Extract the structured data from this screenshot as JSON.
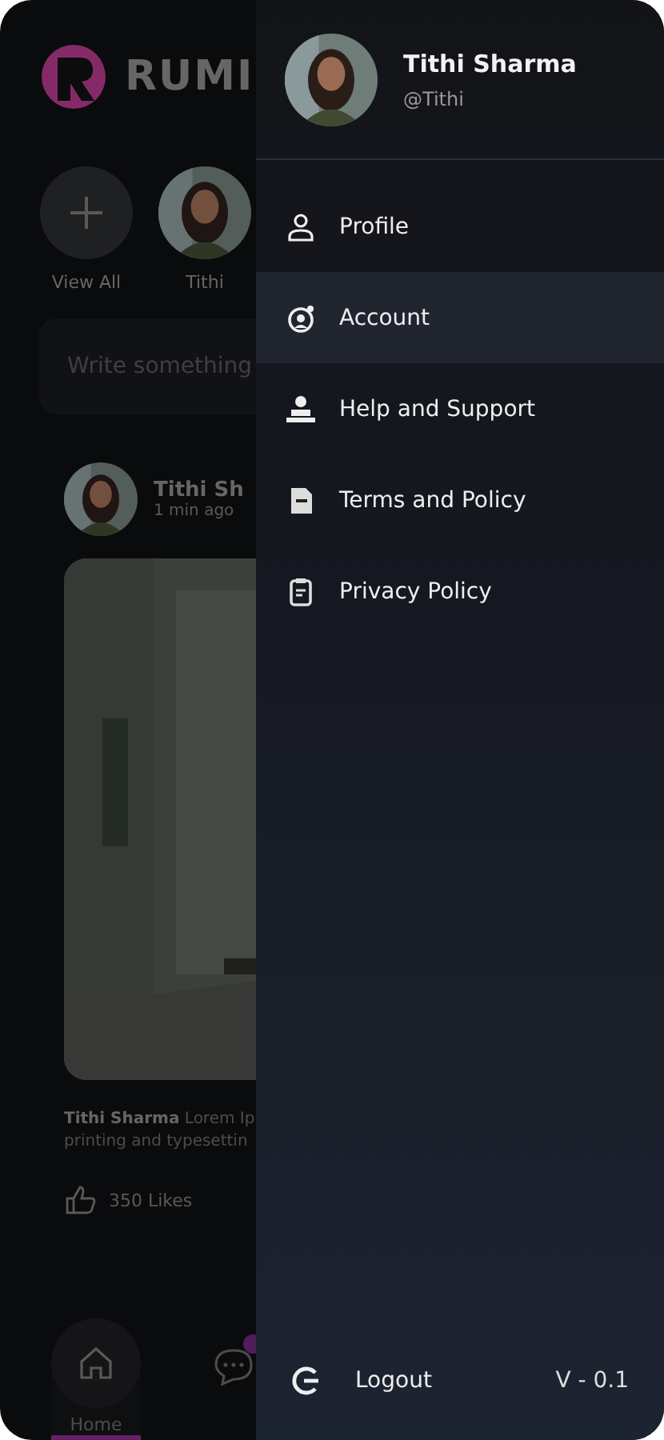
{
  "feed": {
    "logo_text": "RUMI",
    "stories": [
      {
        "kind": "add",
        "label": "View All"
      },
      {
        "kind": "person",
        "label": "Tithi"
      }
    ],
    "composer": {
      "placeholder": "Write something"
    },
    "post": {
      "author": "Tithi Sh",
      "time": "1 min ago",
      "caption_author": "Tithi Sharma",
      "caption_line1": "Lorem Ip",
      "caption_line2": "printing and typesettin",
      "likes": "350 Likes"
    },
    "nav": [
      {
        "kind": "home",
        "label": "Home",
        "selected": true
      },
      {
        "kind": "chat",
        "selected": false
      }
    ]
  },
  "drawer": {
    "user": {
      "name": "Tithi Sharma",
      "handle": "@Tithi"
    },
    "items": [
      {
        "kind": "profile",
        "label": "Profile",
        "selected": false
      },
      {
        "kind": "account",
        "label": "Account",
        "selected": true
      },
      {
        "kind": "help",
        "label": "Help and Support",
        "selected": false
      },
      {
        "kind": "terms",
        "label": "Terms and Policy",
        "selected": false
      },
      {
        "kind": "privacy",
        "label": "Privacy Policy",
        "selected": false
      }
    ],
    "logout": "Logout",
    "version": "V - 0.1"
  }
}
